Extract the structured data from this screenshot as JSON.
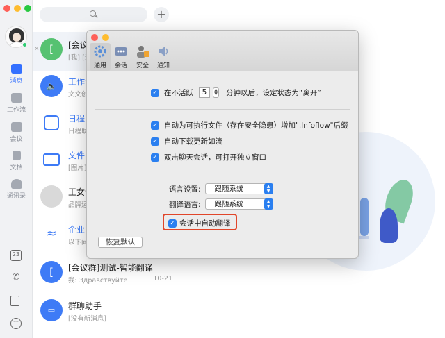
{
  "sidebar": {
    "nav": [
      {
        "label": "消息",
        "active": true
      },
      {
        "label": "工作流",
        "active": false
      },
      {
        "label": "会议",
        "active": false
      },
      {
        "label": "文档",
        "active": false
      },
      {
        "label": "通讯录",
        "active": false
      }
    ],
    "calendar_day": "23"
  },
  "list": {
    "items": [
      {
        "name": "[会议",
        "sub": "[我]:[遗",
        "time": "",
        "avatar_text": "[",
        "color": "#56c271"
      },
      {
        "name": "工作流",
        "sub": "文文创",
        "time": "",
        "avatar_text": "",
        "color": "#3e7bf6"
      },
      {
        "name": "日程",
        "sub": "日程助",
        "time": "",
        "avatar_text": "",
        "color": "#ffffff"
      },
      {
        "name": "文件",
        "sub": "[图片]",
        "time": "",
        "avatar_text": "",
        "color": "#ffffff"
      },
      {
        "name": "王女士",
        "sub": "品牌运",
        "time": "",
        "avatar_text": "",
        "color": "#d9d9d9"
      },
      {
        "name": "企业",
        "sub": "以下问",
        "time": "",
        "avatar_text": "",
        "color": "#ffffff"
      },
      {
        "name": "[会议群]测试-智能翻译",
        "sub": "我: Здравствуйте",
        "time": "10-21",
        "avatar_text": "[",
        "color": "#3e7bf6"
      },
      {
        "name": "群聊助手",
        "sub": "[没有新消息]",
        "time": "",
        "avatar_text": "",
        "color": "#3e7bf6"
      }
    ]
  },
  "dialog": {
    "tabs": [
      {
        "label": "通用",
        "icon": "gear-icon",
        "active": true
      },
      {
        "label": "会话",
        "icon": "chat-dots-icon",
        "active": false
      },
      {
        "label": "安全",
        "icon": "lock-person-icon",
        "active": false
      },
      {
        "label": "通知",
        "icon": "speaker-icon",
        "active": false
      }
    ],
    "inactive": {
      "before": "在不活跃",
      "minutes": "5",
      "after": "分钟以后，设定状态为“离开”"
    },
    "options": [
      "自动为可执行文件（存在安全隐患）增加\".Infoflow\"后缀",
      "自动下载更新如流",
      "双击聊天会话，可打开独立窗口"
    ],
    "language": {
      "label": "语言设置:",
      "value": "跟随系统"
    },
    "translate": {
      "label": "翻译语言:",
      "value": "跟随系统"
    },
    "auto_translate": "会话中自动翻译",
    "reset": "恢复默认",
    "accent": "#2a7ff0",
    "highlight": "#e1462a"
  }
}
